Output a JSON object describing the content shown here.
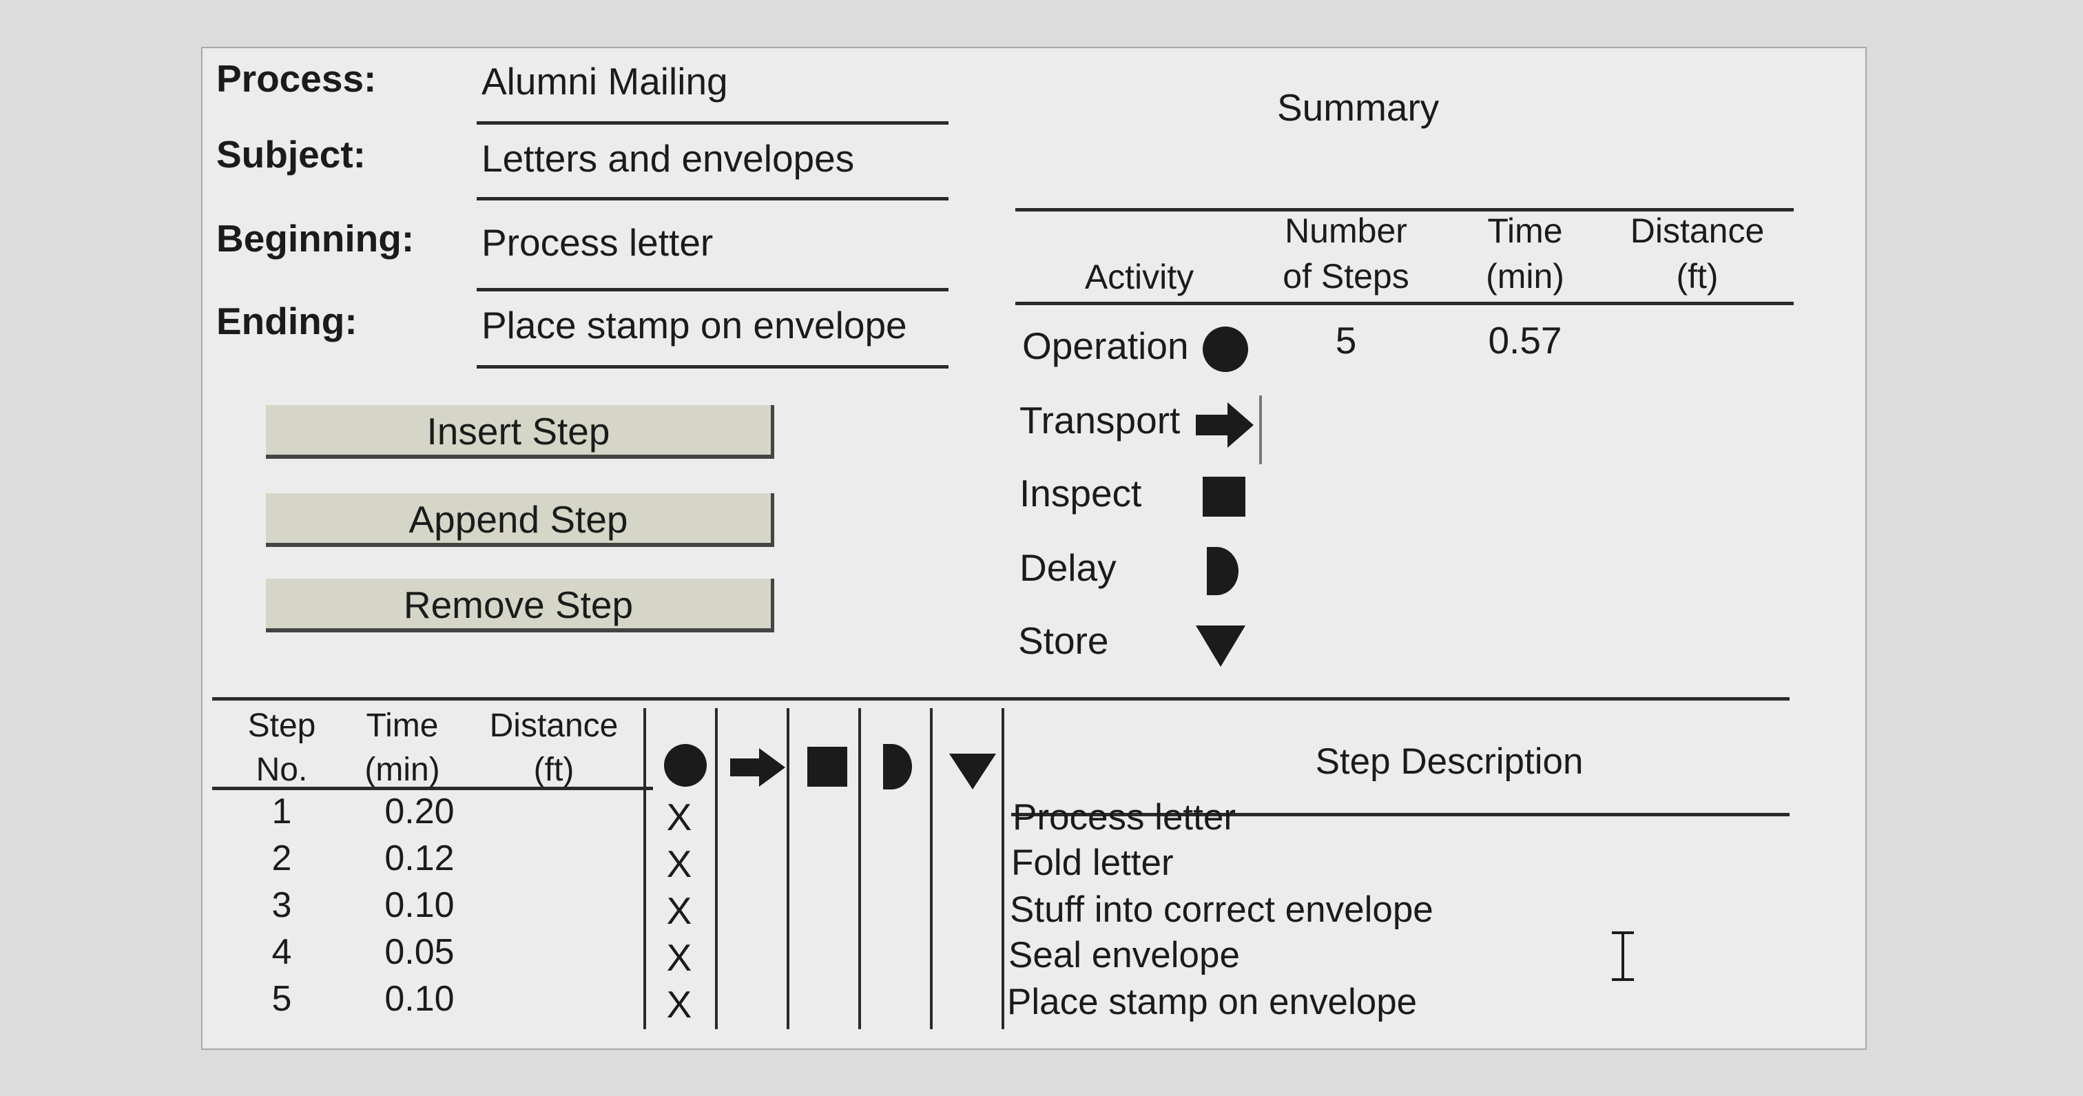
{
  "header": {
    "process_label": "Process:",
    "process_value": "Alumni Mailing",
    "subject_label": "Subject:",
    "subject_value": "Letters and envelopes",
    "beginning_label": "Beginning:",
    "beginning_value": "Process letter",
    "ending_label": "Ending:",
    "ending_value": "Place stamp on envelope"
  },
  "buttons": {
    "insert": "Insert Step",
    "append": "Append Step",
    "remove": "Remove Step"
  },
  "summary": {
    "title": "Summary",
    "col_activity": "Activity",
    "col_steps_1": "Number",
    "col_steps_2": "of Steps",
    "col_time_1": "Time",
    "col_time_2": "(min)",
    "col_dist_1": "Distance",
    "col_dist_2": "(ft)",
    "activities": [
      {
        "name": "Operation",
        "icon": "circle-icon",
        "steps": "5",
        "time": "0.57",
        "distance": ""
      },
      {
        "name": "Transport",
        "icon": "arrow-right-icon",
        "steps": "",
        "time": "",
        "distance": ""
      },
      {
        "name": "Inspect",
        "icon": "square-icon",
        "steps": "",
        "time": "",
        "distance": ""
      },
      {
        "name": "Delay",
        "icon": "d-shape-icon",
        "steps": "",
        "time": "",
        "distance": ""
      },
      {
        "name": "Store",
        "icon": "triangle-down-icon",
        "steps": "",
        "time": "",
        "distance": ""
      }
    ]
  },
  "table": {
    "col_step_1": "Step",
    "col_step_2": "No.",
    "col_time_1": "Time",
    "col_time_2": "(min)",
    "col_dist_1": "Distance",
    "col_dist_2": "(ft)",
    "col_desc": "Step Description",
    "mark": "X",
    "rows": [
      {
        "step": "1",
        "time": "0.20",
        "distance": "",
        "mark": "X",
        "desc": "Process letter"
      },
      {
        "step": "2",
        "time": "0.12",
        "distance": "",
        "mark": "X",
        "desc": "Fold letter"
      },
      {
        "step": "3",
        "time": "0.10",
        "distance": "",
        "mark": "X",
        "desc": "Stuff into correct envelope"
      },
      {
        "step": "4",
        "time": "0.05",
        "distance": "",
        "mark": "X",
        "desc": "Seal envelope"
      },
      {
        "step": "5",
        "time": "0.10",
        "distance": "",
        "mark": "X",
        "desc": "Place stamp on envelope"
      }
    ]
  }
}
